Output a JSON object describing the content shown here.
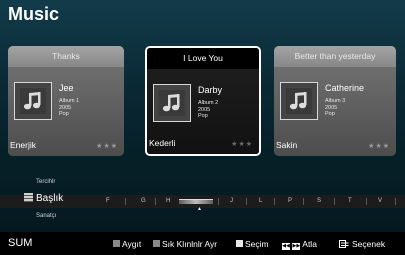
{
  "header": {
    "title": "Music"
  },
  "cards": [
    {
      "title": "Thanks",
      "artist": "Jee",
      "album": "Album 1",
      "year": "2005",
      "genre": "Pop",
      "mood": "Enerjik",
      "rating": "★★★",
      "selected": false
    },
    {
      "title": "I Love You",
      "artist": "Darby",
      "album": "Album 2",
      "year": "2005",
      "genre": "Pop",
      "mood": "Kederli",
      "rating": "★★★",
      "selected": true
    },
    {
      "title": "Better than yesterday",
      "artist": "Catherine",
      "album": "Album 3",
      "year": "2005",
      "genre": "Pop",
      "mood": "Sakin",
      "rating": "★★★",
      "selected": false
    }
  ],
  "sort": {
    "prev": "Tercihlr",
    "current": "Başlık",
    "next": "Sanatçı"
  },
  "index_letters": [
    "F",
    "G",
    "H",
    "J",
    "L",
    "P",
    "S",
    "T",
    "V"
  ],
  "footer": {
    "source": "SUM",
    "device_label": "Aygıt",
    "device_color": "#8a8a8a",
    "frequent_label": "Sık Klınlnlr Ayr",
    "frequent_color": "#8a8a8a",
    "select_label": "Seçim",
    "select_color": "#e8e8e8",
    "jump_label": "Atla",
    "options_label": "Seçenek"
  }
}
